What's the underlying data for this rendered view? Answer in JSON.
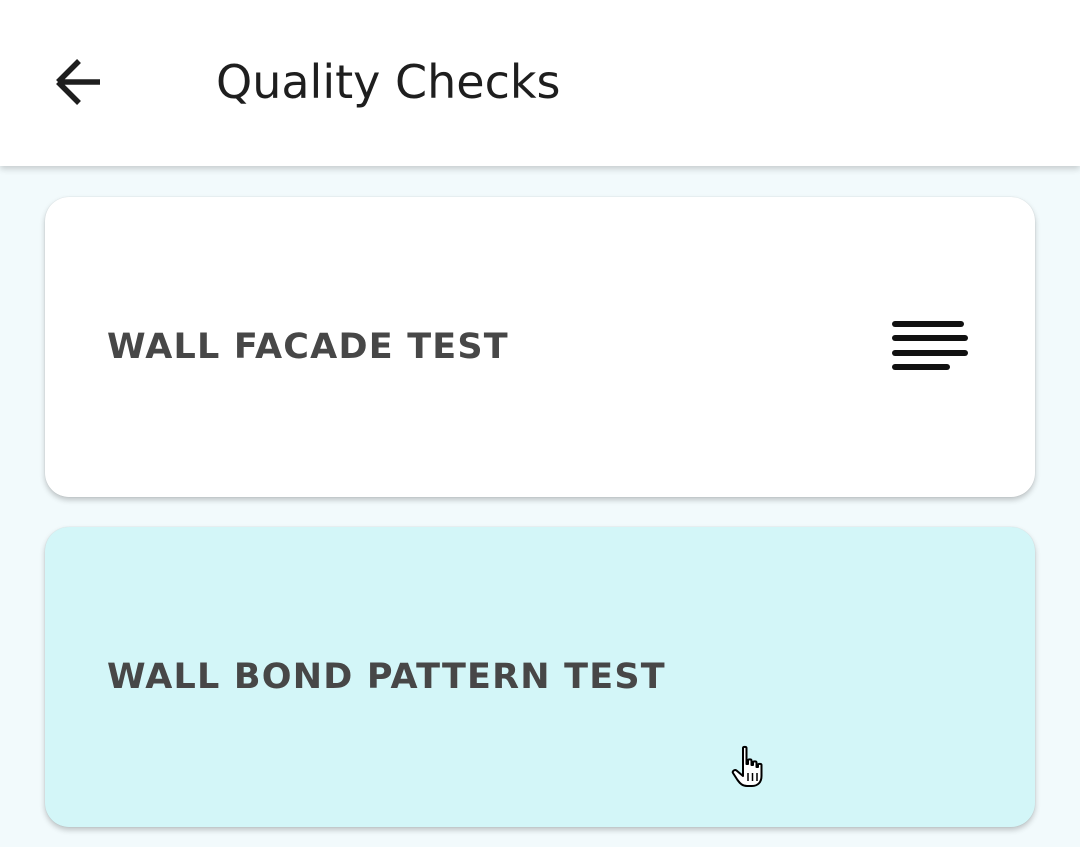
{
  "app_bar": {
    "title": "Quality Checks",
    "back_icon": "arrow-left-icon"
  },
  "checks": [
    {
      "label": "WALL FACADE TEST",
      "icon": "align-left-lines-icon",
      "background": "#ffffff"
    },
    {
      "label": "WALL BOND PATTERN TEST",
      "background": "#d3f6f8"
    }
  ],
  "colors": {
    "page_background": "#f2fafc",
    "highlight_card": "#d3f6f8",
    "card_text": "#474747",
    "title_text": "#1e1e1e"
  }
}
